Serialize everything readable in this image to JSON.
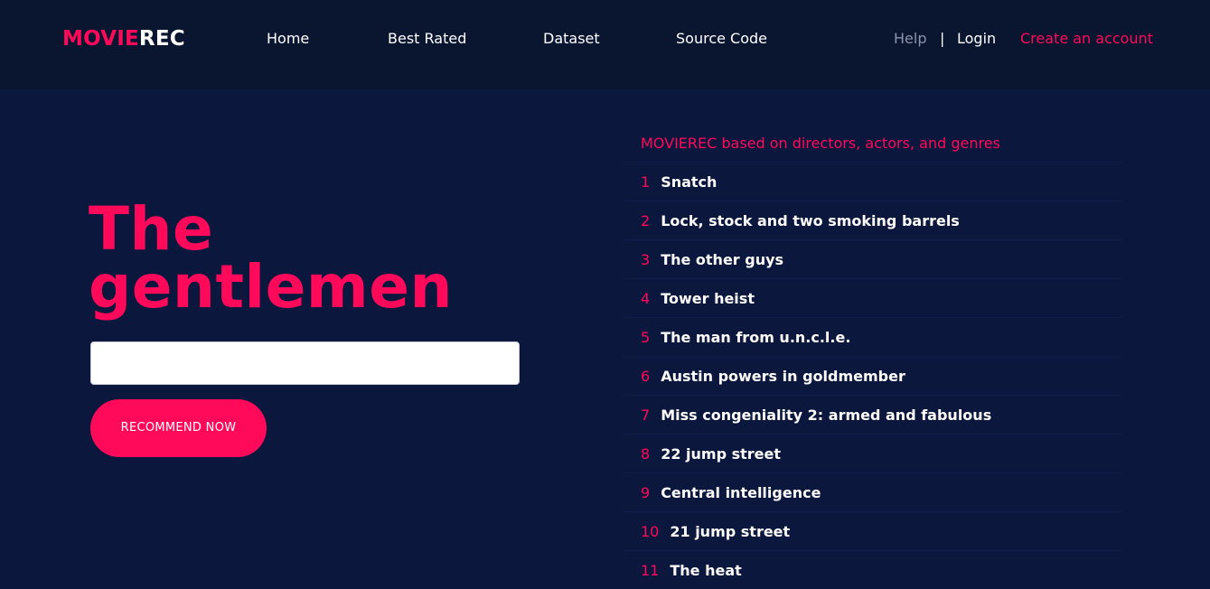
{
  "header": {
    "logo_part1": "MOVIE",
    "logo_part2": "REC",
    "nav": {
      "home": "Home",
      "best_rated": "Best Rated",
      "dataset": "Dataset",
      "source_code": "Source Code"
    },
    "help": "Help",
    "separator": "|",
    "login": "Login",
    "create_account": "Create an account"
  },
  "hero": {
    "title": "The gentlemen",
    "search_value": "",
    "button_label": "RECOMMEND NOW"
  },
  "recommendations": {
    "title": "MOVIEREC based on directors, actors, and genres",
    "items": [
      {
        "rank": "1",
        "title": "Snatch"
      },
      {
        "rank": "2",
        "title": "Lock, stock and two smoking barrels"
      },
      {
        "rank": "3",
        "title": "The other guys"
      },
      {
        "rank": "4",
        "title": "Tower heist"
      },
      {
        "rank": "5",
        "title": "The man from u.n.c.l.e."
      },
      {
        "rank": "6",
        "title": "Austin powers in goldmember"
      },
      {
        "rank": "7",
        "title": "Miss congeniality 2: armed and fabulous"
      },
      {
        "rank": "8",
        "title": "22 jump street"
      },
      {
        "rank": "9",
        "title": "Central intelligence"
      },
      {
        "rank": "10",
        "title": "21 jump street"
      },
      {
        "rank": "11",
        "title": "The heat"
      }
    ]
  },
  "colors": {
    "accent": "#ff0a5a",
    "background": "#0b173d",
    "header_background": "#0a1530"
  }
}
